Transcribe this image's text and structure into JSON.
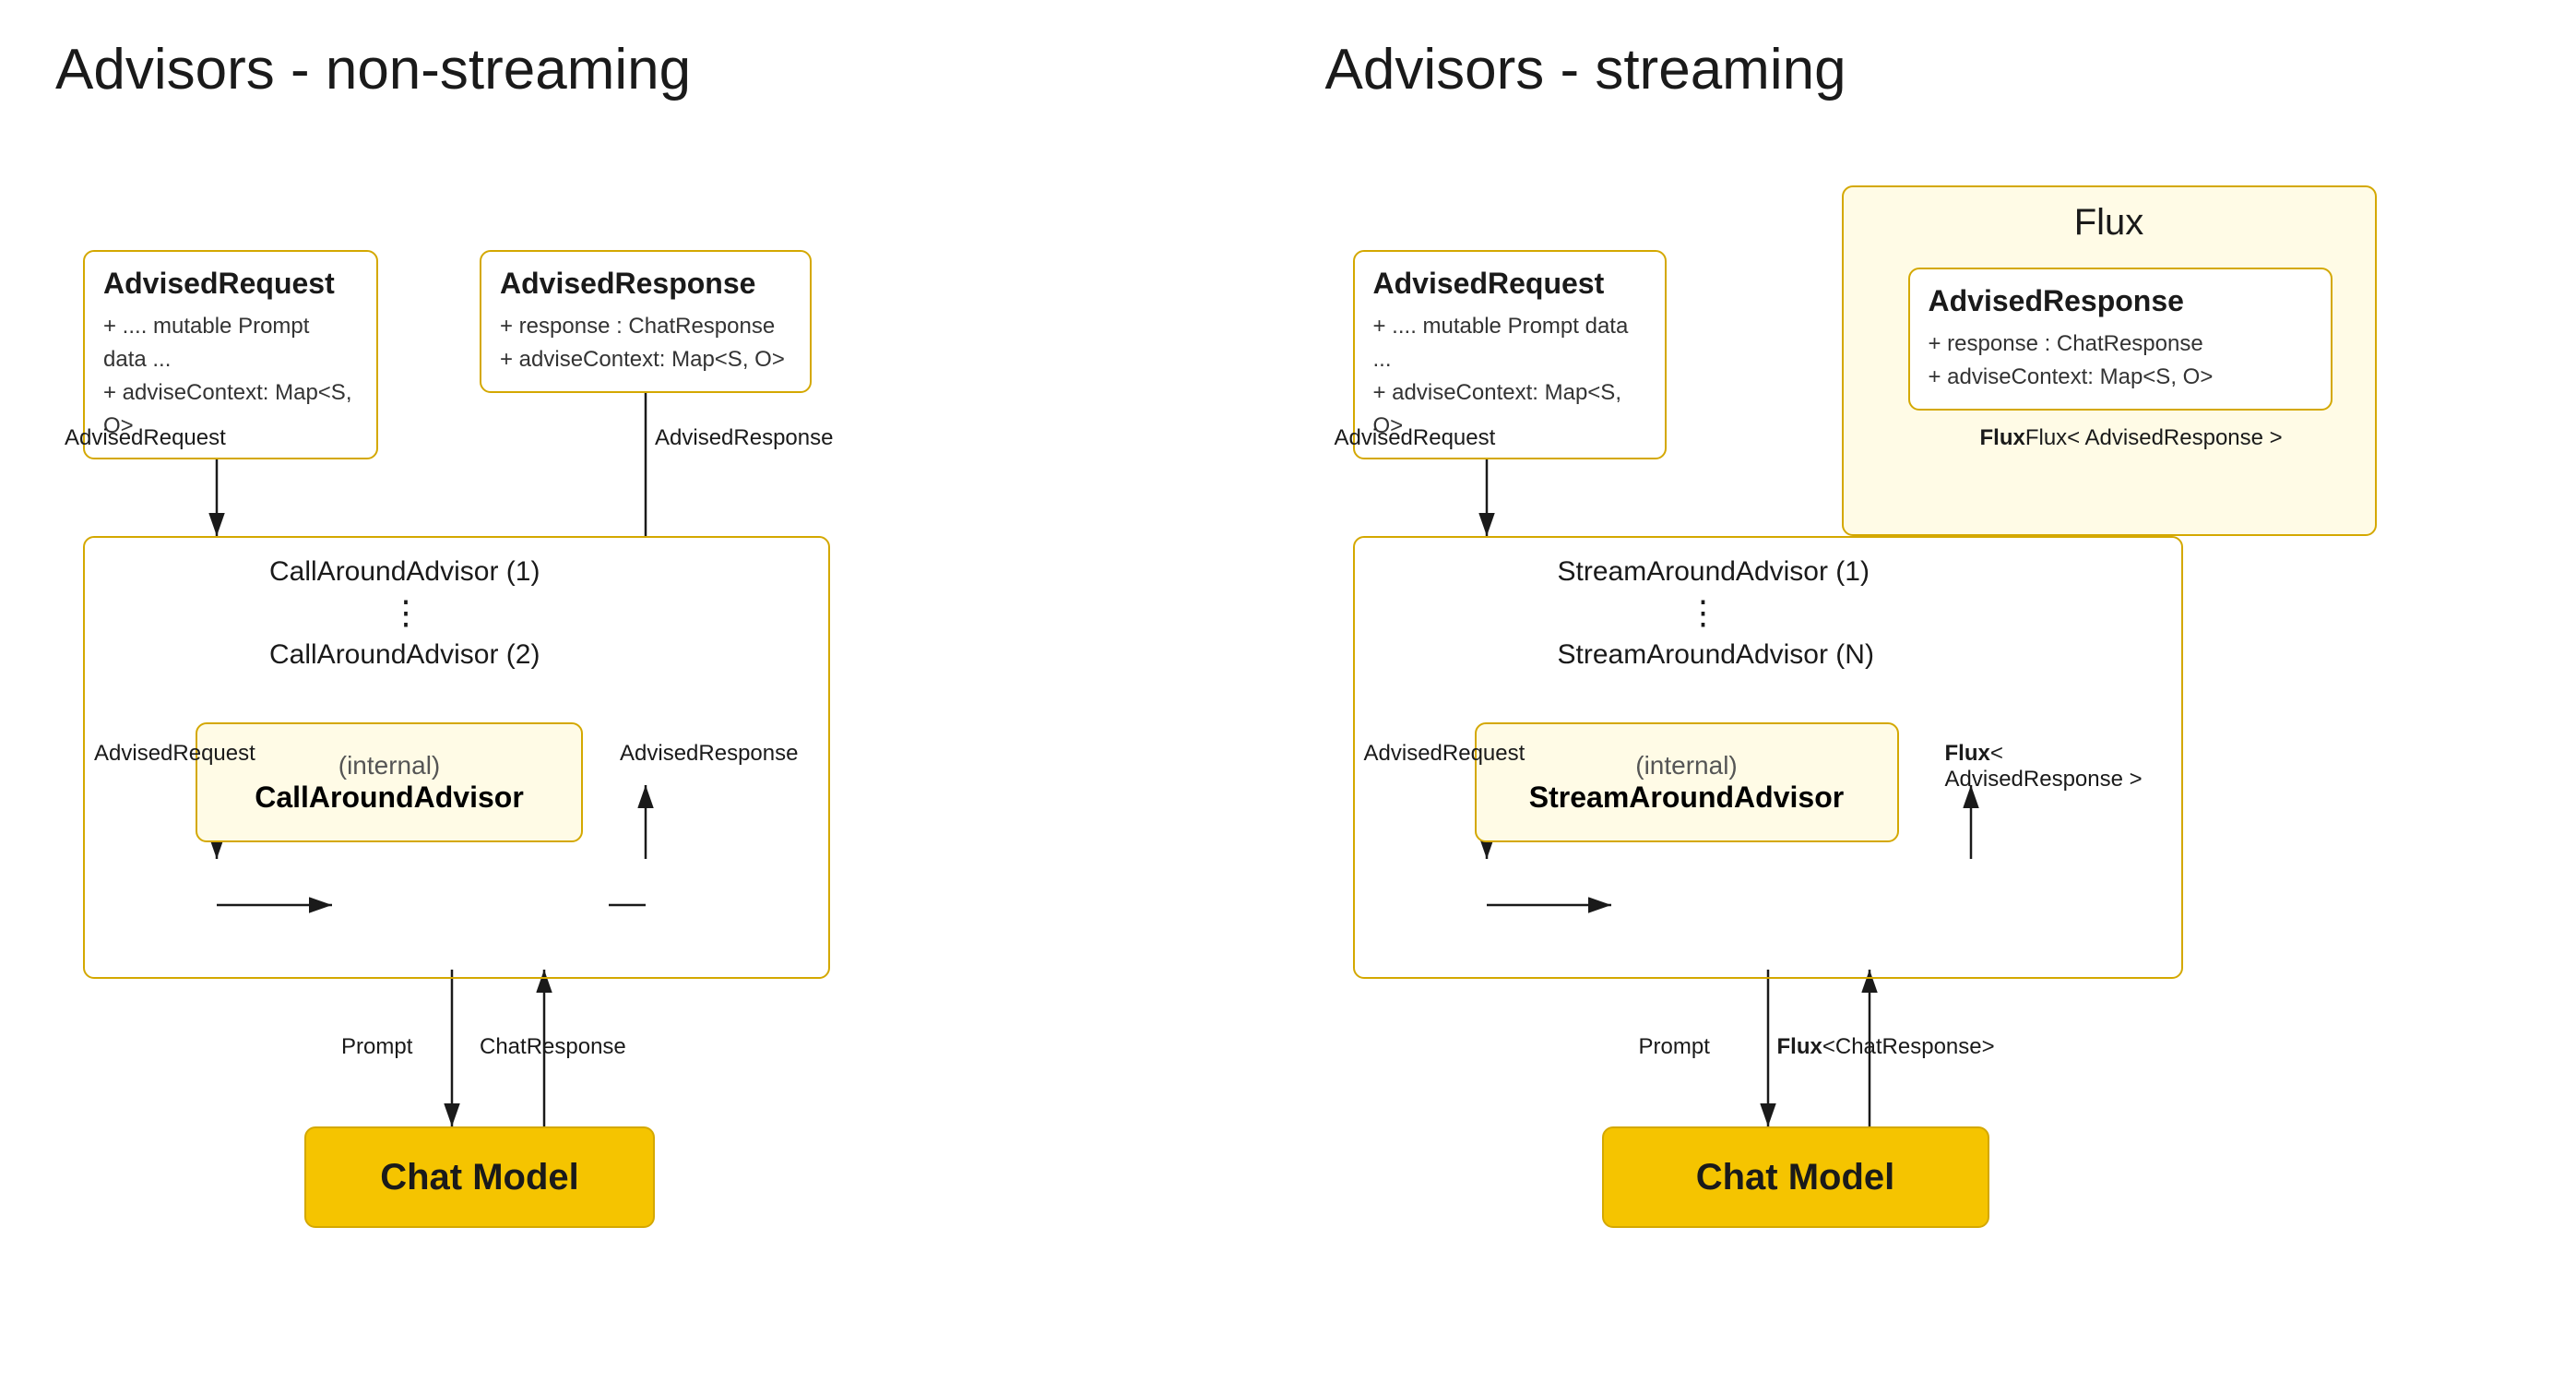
{
  "left_diagram": {
    "title": "Advisors - non-streaming",
    "advised_request_box": {
      "title": "AdvisedRequest",
      "lines": [
        "+ .... mutable Prompt data ...",
        "+ adviseContext: Map<S, O>"
      ]
    },
    "advised_response_box": {
      "title": "AdvisedResponse",
      "lines": [
        "+ response : ChatResponse",
        "+ adviseContext: Map<S, O>"
      ]
    },
    "outer_advisor_label1": "CallAroundAdvisor (1)",
    "dots": "⋮",
    "outer_advisor_label2": "CallAroundAdvisor (2)",
    "inner_advisor": {
      "label1": "(internal)",
      "label2": "CallAroundAdvisor"
    },
    "arrow_labels": {
      "ar1": "AdvisedRequest",
      "ar2": "AdvisedRequest",
      "resp1": "AdvisedResponse",
      "resp2": "AdvisedResponse",
      "prompt": "Prompt",
      "chatresp": "ChatResponse"
    },
    "chat_model": "Chat Model"
  },
  "right_diagram": {
    "title": "Advisors - streaming",
    "flux_outer_label": "Flux",
    "advised_request_box": {
      "title": "AdvisedRequest",
      "lines": [
        "+ .... mutable Prompt data ...",
        "+ adviseContext: Map<S, O>"
      ]
    },
    "advised_response_box": {
      "title": "AdvisedResponse",
      "lines": [
        "+ response : ChatResponse",
        "+ adviseContext: Map<S, O>"
      ]
    },
    "outer_advisor_label1": "StreamAroundAdvisor (1)",
    "dots": "⋮",
    "outer_advisor_label2": "StreamAroundAdvisor (N)",
    "inner_advisor": {
      "label1": "(internal)",
      "label2": "StreamAroundAdvisor"
    },
    "arrow_labels": {
      "ar1": "AdvisedRequest",
      "ar2": "AdvisedRequest",
      "resp1": "Flux< AdvisedResponse >",
      "resp2": "Flux< AdvisedResponse >",
      "prompt": "Prompt",
      "fluxresp": "Flux<ChatResponse>"
    },
    "chat_model": "Chat Model"
  }
}
